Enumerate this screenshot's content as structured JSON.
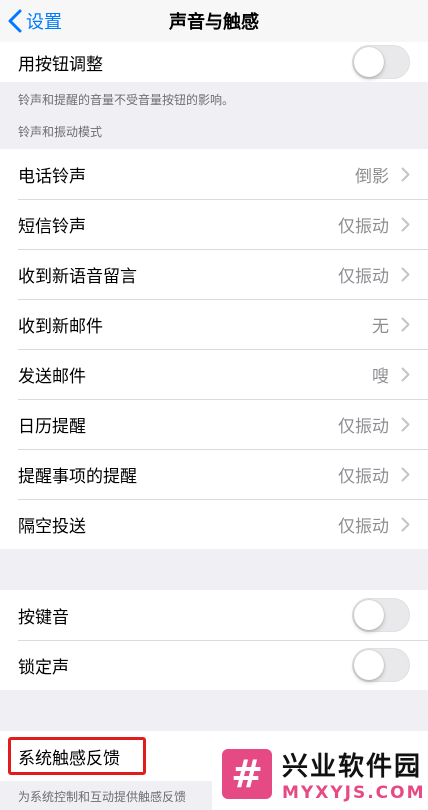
{
  "nav": {
    "back_label": "设置",
    "title": "声音与触感"
  },
  "button_adjust": {
    "label": "用按钮调整",
    "enabled": false,
    "footer": "铃声和提醒的音量不受音量按钮的影响。"
  },
  "sound_patterns": {
    "header": "铃声和振动模式",
    "items": [
      {
        "label": "电话铃声",
        "value": "倒影"
      },
      {
        "label": "短信铃声",
        "value": "仅振动"
      },
      {
        "label": "收到新语音留言",
        "value": "仅振动"
      },
      {
        "label": "收到新邮件",
        "value": "无"
      },
      {
        "label": "发送邮件",
        "value": "嗖"
      },
      {
        "label": "日历提醒",
        "value": "仅振动"
      },
      {
        "label": "提醒事项的提醒",
        "value": "仅振动"
      },
      {
        "label": "隔空投送",
        "value": "仅振动"
      }
    ]
  },
  "sound_toggles": {
    "items": [
      {
        "label": "按键音",
        "enabled": false
      },
      {
        "label": "锁定声",
        "enabled": false
      }
    ]
  },
  "haptics": {
    "label": "系统触感反馈",
    "footer": "为系统控制和互动提供触感反馈"
  },
  "watermark": {
    "logo_glyph": "#",
    "title": "兴业软件园",
    "url": "MYXYJS.COM"
  },
  "colors": {
    "accent": "#007aff",
    "highlight_box": "#e21c1c",
    "watermark_pink": "#e64a84"
  }
}
